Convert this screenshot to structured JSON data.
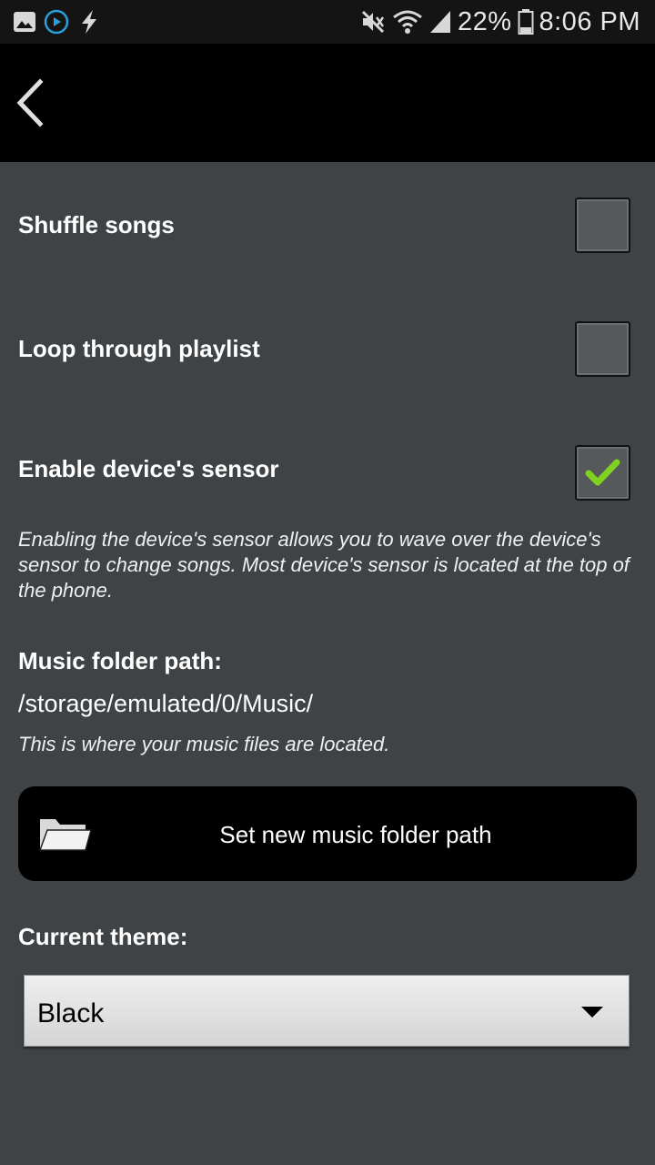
{
  "status_bar": {
    "battery_percent": "22%",
    "time": "8:06 PM",
    "icons": [
      "image-icon",
      "play-circle-icon",
      "bolt-icon",
      "mute-icon",
      "wifi-icon",
      "cell-signal-icon",
      "battery-icon"
    ]
  },
  "action_bar": {
    "back_icon": "chevron-left-icon"
  },
  "settings": {
    "shuffle": {
      "label": "Shuffle songs",
      "checked": false
    },
    "loop": {
      "label": "Loop through playlist",
      "checked": false
    },
    "sensor": {
      "label": "Enable device's sensor",
      "checked": true,
      "description": " Enabling the device's sensor allows you to wave over the device's sensor to change songs. Most device's sensor is located at the top of the phone."
    },
    "music_folder": {
      "heading": "Music folder path:",
      "path": "/storage/emulated/0/Music/",
      "note": "This is where your music files are located.",
      "button_label": "Set new music folder path"
    },
    "theme": {
      "heading": "Current theme:",
      "selected": "Black"
    }
  },
  "colors": {
    "background": "#3f4346",
    "action_bar": "#000000",
    "status_bar": "#141414",
    "check_mark": "#7ed321"
  }
}
